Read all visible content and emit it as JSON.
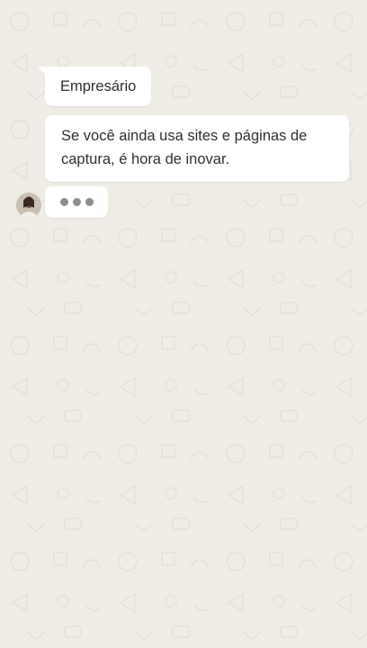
{
  "chat": {
    "messages": [
      {
        "text": "Empresário"
      },
      {
        "text": "Se você ainda usa sites e páginas de captura, é hora de inovar."
      }
    ],
    "typing": {
      "dots": 3
    }
  },
  "colors": {
    "wallpaper": "#efece6",
    "bubble": "#ffffff",
    "text": "#303030",
    "typing_dot": "#8d8d8d"
  },
  "icons": {
    "avatar": "contact-avatar-photo"
  }
}
